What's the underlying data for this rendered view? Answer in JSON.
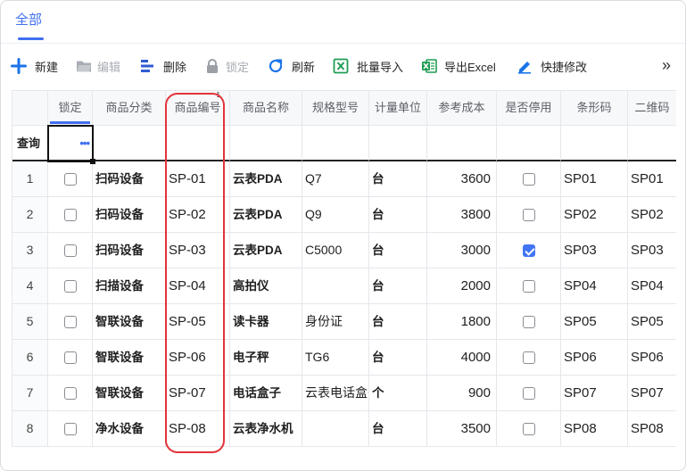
{
  "tabs": [
    {
      "label": "全部",
      "active": true
    }
  ],
  "toolbar": {
    "buttons": [
      {
        "label": "新建",
        "icon": "plus-icon",
        "enabled": true
      },
      {
        "label": "编辑",
        "icon": "folder-edit-icon",
        "enabled": false
      },
      {
        "label": "删除",
        "icon": "delete-icon",
        "enabled": true
      },
      {
        "label": "锁定",
        "icon": "lock-icon",
        "enabled": false
      },
      {
        "label": "刷新",
        "icon": "refresh-icon",
        "enabled": true
      },
      {
        "label": "批量导入",
        "icon": "excel-import-icon",
        "enabled": true
      },
      {
        "label": "导出Excel",
        "icon": "excel-export-icon",
        "enabled": true
      },
      {
        "label": "快捷修改",
        "icon": "pencil-icon",
        "enabled": true
      }
    ],
    "more": "»"
  },
  "table": {
    "columns": [
      "锁定",
      "商品分类",
      "商品编号",
      "商品名称",
      "规格型号",
      "计量单位",
      "参考成本",
      "是否停用",
      "条形码",
      "二维码"
    ],
    "sort_order": "1",
    "query_label": "查询",
    "query_more": "•••",
    "rows": [
      {
        "no": "1",
        "locked": false,
        "category": "扫码设备",
        "code": "SP-01",
        "name": "云表PDA",
        "spec": "Q7",
        "unit": "台",
        "cost": "3600",
        "disabled": false,
        "barcode": "SP01",
        "qrcode": "SP01"
      },
      {
        "no": "2",
        "locked": false,
        "category": "扫码设备",
        "code": "SP-02",
        "name": "云表PDA",
        "spec": "Q9",
        "unit": "台",
        "cost": "3800",
        "disabled": false,
        "barcode": "SP02",
        "qrcode": "SP02"
      },
      {
        "no": "3",
        "locked": false,
        "category": "扫码设备",
        "code": "SP-03",
        "name": "云表PDA",
        "spec": "C5000",
        "unit": "台",
        "cost": "3000",
        "disabled": true,
        "barcode": "SP03",
        "qrcode": "SP03"
      },
      {
        "no": "4",
        "locked": false,
        "category": "扫描设备",
        "code": "SP-04",
        "name": "高拍仪",
        "spec": "",
        "unit": "台",
        "cost": "2000",
        "disabled": false,
        "barcode": "SP04",
        "qrcode": "SP04"
      },
      {
        "no": "5",
        "locked": false,
        "category": "智联设备",
        "code": "SP-05",
        "name": "读卡器",
        "spec": "身份证",
        "unit": "台",
        "cost": "1800",
        "disabled": false,
        "barcode": "SP05",
        "qrcode": "SP05"
      },
      {
        "no": "6",
        "locked": false,
        "category": "智联设备",
        "code": "SP-06",
        "name": "电子秤",
        "spec": "TG6",
        "unit": "台",
        "cost": "4000",
        "disabled": false,
        "barcode": "SP06",
        "qrcode": "SP06"
      },
      {
        "no": "7",
        "locked": false,
        "category": "智联设备",
        "code": "SP-07",
        "name": "电话盒子",
        "spec": "云表电话盒子",
        "unit": "个",
        "cost": "900",
        "disabled": false,
        "barcode": "SP07",
        "qrcode": "SP07"
      },
      {
        "no": "8",
        "locked": false,
        "category": "净水设备",
        "code": "SP-08",
        "name": "云表净水机",
        "spec": "",
        "unit": "台",
        "cost": "3500",
        "disabled": false,
        "barcode": "SP08",
        "qrcode": "SP08"
      }
    ]
  },
  "colors": {
    "accent": "#3f6ff0",
    "annotation": "#e2333a",
    "excel_green": "#1f9d55",
    "disabled": "#a8abb2",
    "checked": "#4275f4"
  }
}
